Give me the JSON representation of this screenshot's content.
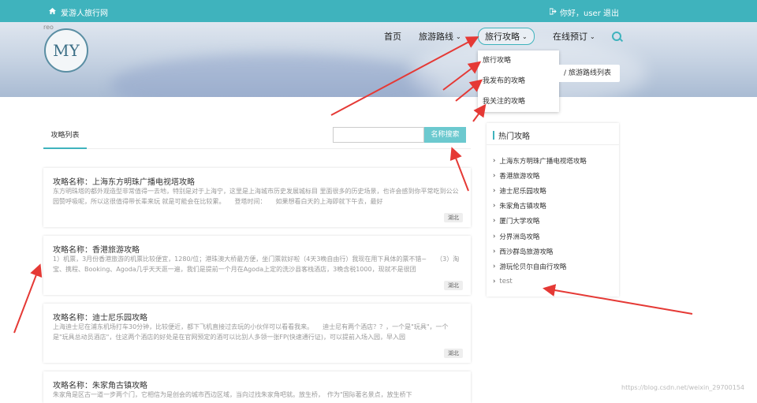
{
  "topbar": {
    "site_name": "爱游人旅行网",
    "user_text": "你好，user 退出"
  },
  "logo": {
    "small_text": "reo",
    "mark": "MY"
  },
  "nav": {
    "home": "首页",
    "routes": "旅游路线",
    "guides": "旅行攻略",
    "booking": "在线预订"
  },
  "dropdown": {
    "items": [
      "旅行攻略",
      "我发布的攻略",
      "我关注的攻略"
    ]
  },
  "route_list_btn": "/ 旅游路线列表",
  "list_panel": {
    "tab": "攻略列表",
    "search_btn": "名称搜索"
  },
  "cards": [
    {
      "title": "攻略名称：上海东方明珠广播电视塔攻略",
      "desc": "东方明珠塔的都外观造型非常值得一去地，特别是对于上海宁，这里是上海城市历史发展城标目 里面很多的历史场景，也许会感到你平常吃到公公园赞呼吸呢，所以这很值得带长辈来玩 就是可能会在比较累。　　登塔时间：　　如果想看白天的上海即就下午去，最好",
      "tag": "湖北"
    },
    {
      "title": "攻略名称：香港旅游攻略",
      "desc": "1）机票，3月份香港旅游的机票比较便宜，1280/位；港珠澳大桥最方便，坐门票就好啦（4天3晚自由行）我现在用下具体的票不错~　　（3）淘宝、携程、Booking、Agoda几乎天天逛一遍，我们是提前一个月在Agoda上定的洗沙县客栈酒店，3晚含税1000，现就不是很团",
      "tag": "湖北"
    },
    {
      "title": "攻略名称：迪士尼乐园攻略",
      "desc": "上海迪士尼在浦东机场打车30分钟，比较便近，都下飞机直接过去玩的小伙伴可以看看我来。　　迪士尼有两个酒店？？，一个是\"玩具\"，一个是\"玩具总动员酒店\"，住这两个酒店的好处是在官网预定的酒可以比别人多领一张FP(快速通行证)，可以提前入场入园，早入园",
      "tag": "湖北"
    },
    {
      "title": "攻略名称：朱家角古镇攻略",
      "desc": "朱家角是区古一道一步两个门，它相信为是创会的城市西边区域，当向过找朱家角吧就。放生桥，　作为\"国际著名景点，放生桥下",
      "tag": "湖北"
    }
  ],
  "sidebar": {
    "title": "热门攻略",
    "items": [
      "上海东方明珠广播电视塔攻略",
      "香港旅游攻略",
      "迪士尼乐园攻略",
      "朱家角古镇攻略",
      "厦门大学攻略",
      "分界洲岛攻略",
      "西沙群岛旅游攻略",
      "游玩伦贝尔自由行攻略",
      "test"
    ]
  },
  "watermark": "https://blog.csdn.net/weixin_29700154",
  "colors": {
    "accent": "#3fb3bd",
    "arrow": "#e53935"
  }
}
